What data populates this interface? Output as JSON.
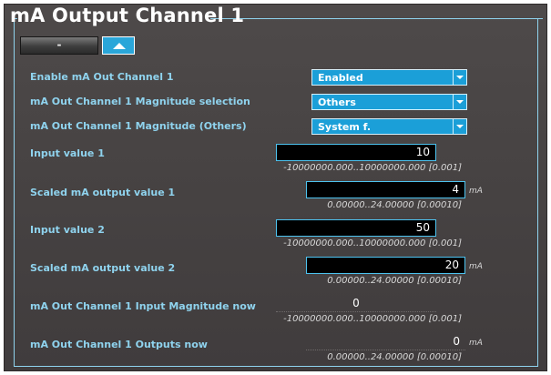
{
  "panel": {
    "title": "mA Output Channel 1",
    "collapse_button_label": "-",
    "scroll_up_icon": "triangle-up-icon"
  },
  "rows": {
    "enable": {
      "label": "Enable mA Out Channel 1",
      "value": "Enabled"
    },
    "magnitude_selection": {
      "label": "mA Out Channel 1 Magnitude selection",
      "value": "Others"
    },
    "magnitude_others": {
      "label": "mA Out Channel 1 Magnitude (Others)",
      "value": "System f."
    },
    "input_value_1": {
      "label": "Input value 1",
      "value": "10",
      "range": "-10000000.000..10000000.000 [0.001]"
    },
    "scaled_output_1": {
      "label": "Scaled mA output value 1",
      "value": "4",
      "unit": "mA",
      "range": "0.00000..24.00000 [0.00010]"
    },
    "input_value_2": {
      "label": "Input value 2",
      "value": "50",
      "range": "-10000000.000..10000000.000 [0.001]"
    },
    "scaled_output_2": {
      "label": "Scaled mA output value 2",
      "value": "20",
      "unit": "mA",
      "range": "0.00000..24.00000 [0.00010]"
    },
    "input_magnitude_now": {
      "label": "mA Out Channel 1 Input Magnitude now",
      "value": "0",
      "range": "-10000000.000..10000000.000 [0.001]"
    },
    "outputs_now": {
      "label": "mA Out Channel 1 Outputs now",
      "value": "0",
      "unit": "mA",
      "range": "0.00000..24.00000 [0.00010]"
    }
  },
  "colors": {
    "accent": "#1b9fd8",
    "label": "#8fd3ee",
    "panel_bg": "#474343"
  }
}
